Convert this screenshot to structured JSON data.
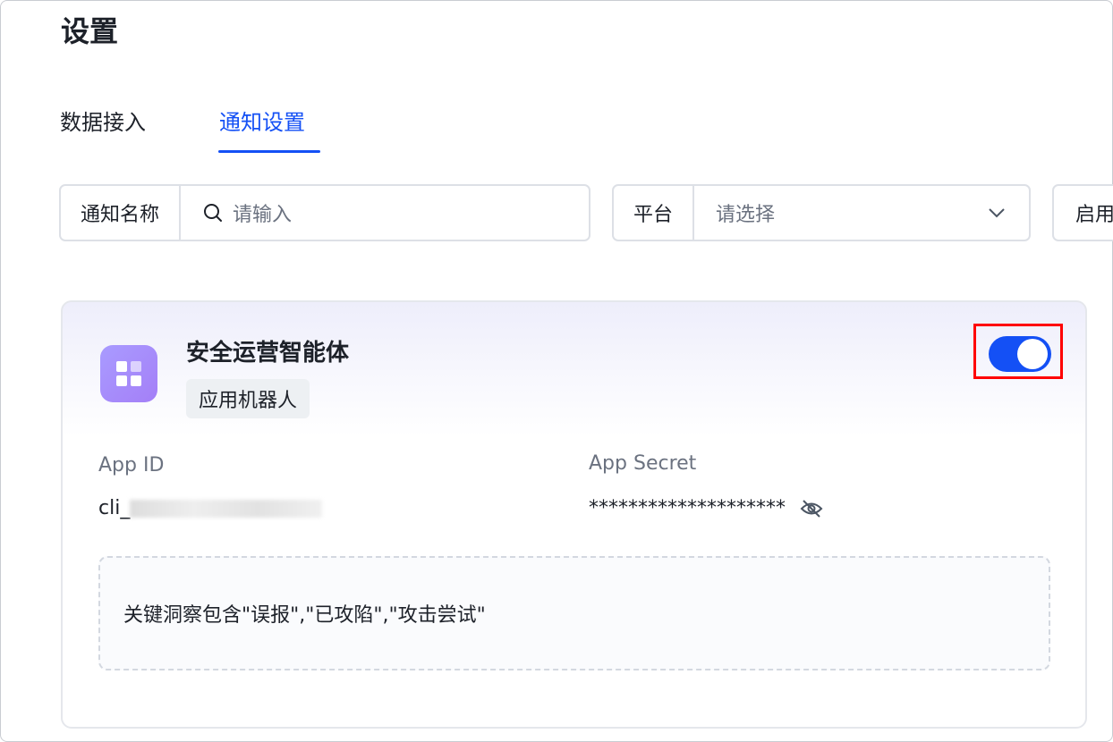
{
  "page": {
    "title": "设置"
  },
  "tabs": [
    {
      "label": "数据接入",
      "active": false
    },
    {
      "label": "通知设置",
      "active": true
    }
  ],
  "filters": {
    "name": {
      "label": "通知名称",
      "placeholder": "请输入"
    },
    "platform": {
      "label": "平台",
      "placeholder": "请选择"
    },
    "enabled": {
      "label": "启用"
    }
  },
  "card": {
    "name": "安全运营智能体",
    "tag": "应用机器人",
    "enabled": true,
    "app_id_label": "App ID",
    "app_id_prefix": "cli_",
    "app_secret_label": "App Secret",
    "app_secret": "********************",
    "note": "关键洞察包含\"误报\",\"已攻陷\",\"攻击尝试\""
  },
  "colors": {
    "accent": "#1450f5",
    "highlight": "#ff0000"
  }
}
